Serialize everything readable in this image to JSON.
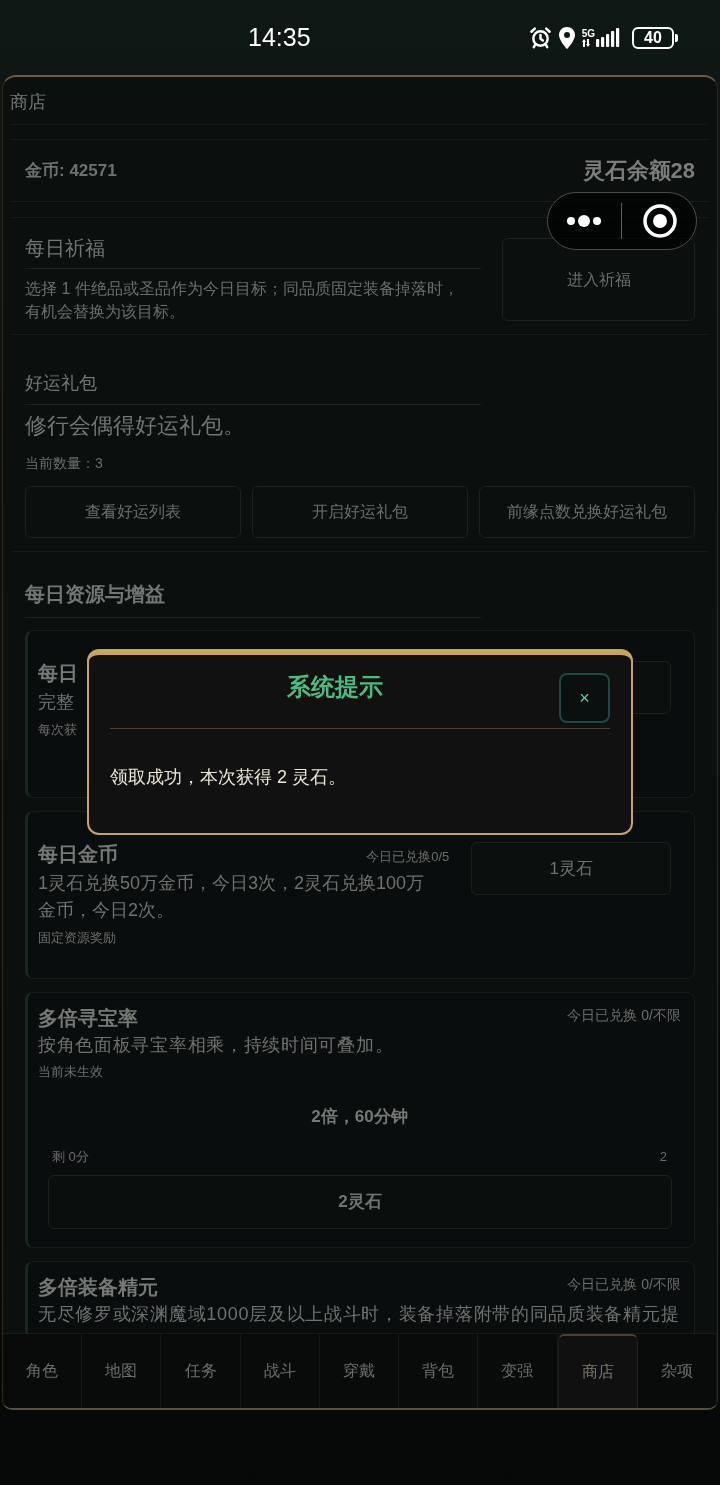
{
  "status_bar": {
    "time": "14:35",
    "network": "5G",
    "battery": "40"
  },
  "header": {
    "title": "商店"
  },
  "balance": {
    "gold": "金币: 42571",
    "spirit_stones": "灵石余额28"
  },
  "blessing": {
    "title": "每日祈福",
    "description": "选择 1 件绝品或圣品作为今日目标；同品质固定装备掉落时，有机会替换为该目标。",
    "button": "进入祈福"
  },
  "lucky_pack": {
    "title": "好运礼包",
    "description": "修行会偶得好运礼包。",
    "count": "当前数量：3",
    "buttons": [
      "查看好运列表",
      "开启好运礼包",
      "前缘点数兑换好运礼包"
    ]
  },
  "daily_resources": {
    "title": "每日资源与增益",
    "cards": [
      {
        "kind": "button",
        "title": "每日",
        "description": "完整",
        "note": "每次获"
      },
      {
        "kind": "button",
        "title": "每日金币",
        "quota": "今日已兑换0/5",
        "description": "1灵石兑换50万金币，今日3次，2灵石兑换100万金币，今日2次。",
        "note": "固定资源奖励",
        "button": "1灵石"
      },
      {
        "kind": "slider",
        "title": "多倍寻宝率",
        "quota": "今日已兑换 0/不限",
        "description": "按角色面板寻宝率相乘，持续时间可叠加。",
        "note": "当前未生效",
        "amount": "2倍，60分钟",
        "min_label": "剩 0分",
        "max_label": "2",
        "button": "2灵石"
      },
      {
        "kind": "slider",
        "title": "多倍装备精元",
        "quota": "今日已兑换 0/不限",
        "description": "无尽修罗或深渊魔域1000层及以上战斗时，装备掉落附带的同品质装备精元提"
      }
    ]
  },
  "tabs": [
    {
      "label": "角色",
      "selected": false
    },
    {
      "label": "地图",
      "selected": false
    },
    {
      "label": "任务",
      "selected": false
    },
    {
      "label": "战斗",
      "selected": false
    },
    {
      "label": "穿戴",
      "selected": false
    },
    {
      "label": "背包",
      "selected": false
    },
    {
      "label": "变强",
      "selected": false
    },
    {
      "label": "商店",
      "selected": true
    },
    {
      "label": "杂项",
      "selected": false
    }
  ],
  "dialog": {
    "title": "系统提示",
    "close": "×",
    "message": "领取成功，本次获得 2 灵石。"
  }
}
